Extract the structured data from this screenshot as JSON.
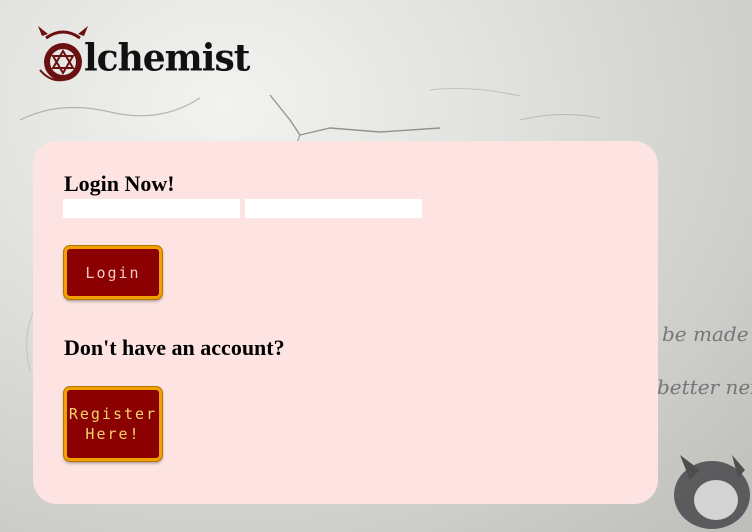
{
  "logo": {
    "text": "lchemist",
    "icon": "alchemy-emblem-icon"
  },
  "background": {
    "writing_line_1": "be made w",
    "writing_line_2": "better next"
  },
  "login": {
    "heading": "Login Now!",
    "username_value": "",
    "password_value": "",
    "button_label": "Login"
  },
  "register": {
    "heading": "Don't have an account?",
    "button_label": "Register\nHere!"
  },
  "colors": {
    "card_background": "#fde4e2",
    "button_background": "#8b0000",
    "button_border": "#f0a000",
    "button_text": "#f3d36b"
  }
}
